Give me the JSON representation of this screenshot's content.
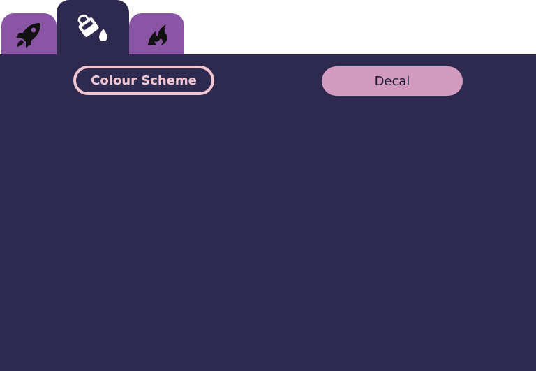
{
  "tabs": [
    {
      "icon": "rocket-icon",
      "active": false
    },
    {
      "icon": "paint-bucket-icon",
      "active": true
    },
    {
      "icon": "flame-icon",
      "active": false
    }
  ],
  "panel": {
    "colour_scheme_label": "Colour Scheme",
    "decal_label": "Decal"
  },
  "colors": {
    "active_bg": "#2e2a4f",
    "inactive_tab": "#8b55a5",
    "accent_pink": "#f2c6d1",
    "decal_bg": "#d39bbf"
  }
}
